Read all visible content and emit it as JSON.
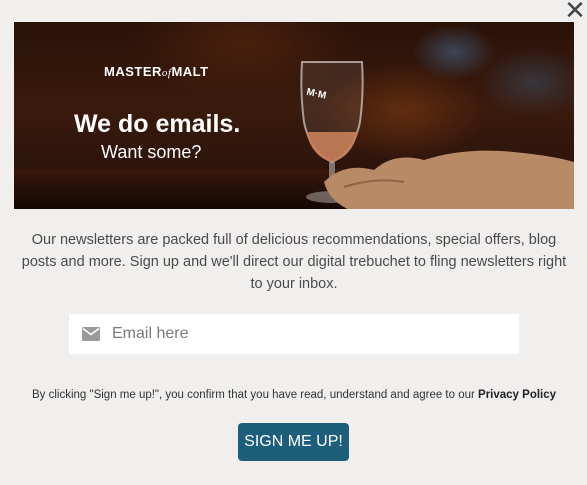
{
  "dialog": {
    "close_glyph": "✕"
  },
  "hero": {
    "logo_left": "MASTER",
    "logo_of": "of",
    "logo_right": "MALT",
    "headline": "We do emails.",
    "subhead": "Want some?"
  },
  "body": {
    "description": "Our newsletters are packed full of delicious recommendations, special offers, blog posts and more. Sign up and we'll direct our digital trebuchet to fling newsletters right to your inbox."
  },
  "form": {
    "email_placeholder": "Email here",
    "email_value": "",
    "terms_text": "By clicking \"Sign me up!\", you confirm that you have read, understand and agree to our ",
    "privacy_link": "Privacy Policy",
    "submit_label": "SIGN ME UP!"
  },
  "colors": {
    "background": "#f1efed",
    "button": "#1d5f7a"
  },
  "icons": [
    "close-icon",
    "mail-icon"
  ]
}
